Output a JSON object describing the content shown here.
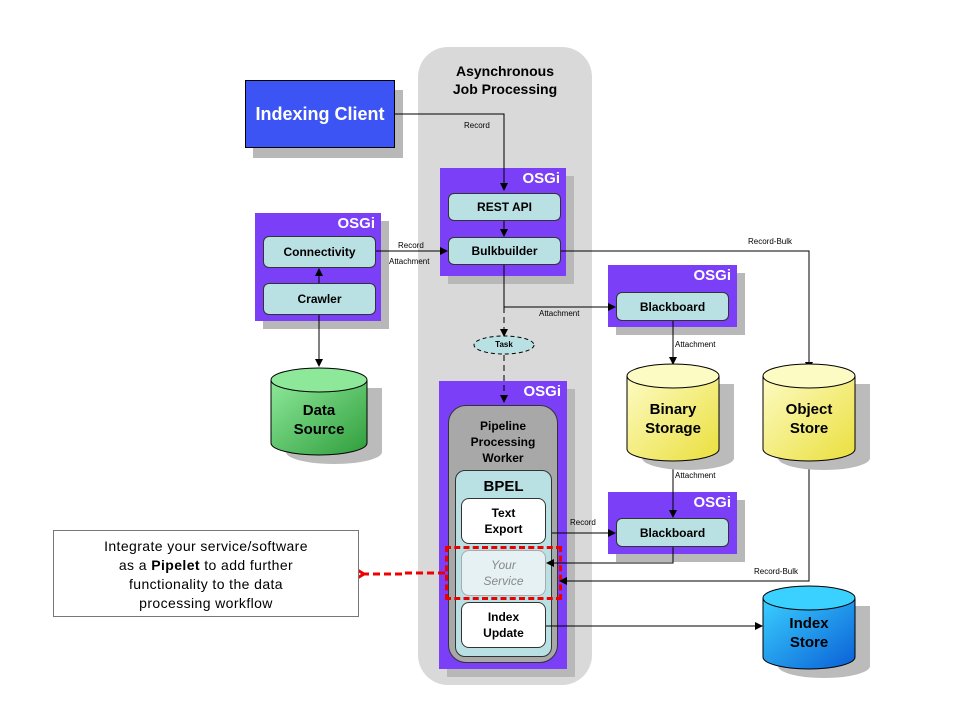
{
  "diagram": {
    "group_title_line1": "Asynchronous",
    "group_title_line2": "Job Processing",
    "indexing_client": "Indexing Client",
    "osgi_label": "OSGi",
    "modules": {
      "rest_api": "REST API",
      "bulkbuilder": "Bulkbuilder",
      "connectivity": "Connectivity",
      "crawler": "Crawler",
      "blackboard_top": "Blackboard",
      "blackboard_bottom": "Blackboard"
    },
    "task": "Task",
    "worker": {
      "line1": "Pipeline",
      "line2": "Processing",
      "line3": "Worker"
    },
    "bpel": "BPEL",
    "pipelets": {
      "text_export_1": "Text",
      "text_export_2": "Export",
      "your_service_1": "Your",
      "your_service_2": "Service",
      "index_update_1": "Index",
      "index_update_2": "Update"
    },
    "stores": {
      "data_source_1": "Data",
      "data_source_2": "Source",
      "binary_storage_1": "Binary",
      "binary_storage_2": "Storage",
      "object_store_1": "Object",
      "object_store_2": "Store",
      "index_store_1": "Index",
      "index_store_2": "Store"
    },
    "edge_labels": {
      "record_client": "Record",
      "record_connectivity": "Record",
      "attachment_connectivity": "Attachment",
      "record_bulk_top": "Record-Bulk",
      "attachment_bulk": "Attachment",
      "attachment_bb_top": "Attachment",
      "attachment_binary": "Attachment",
      "record_text_export": "Record",
      "record_bulk_bottom": "Record-Bulk"
    },
    "callout": {
      "line1": "Integrate  your  service/software",
      "line2_pre": "as a ",
      "line2_bold": "Pipelet",
      "line2_post": " to add further",
      "line3": "functionality  to the  data",
      "line4": "processing  workflow"
    },
    "colors": {
      "osgi": "#7b3ff7",
      "module": "#b9e0e3",
      "client": "#3d54f5",
      "data_source": "#4cc25a",
      "storage_yellow": "#f5ef7a",
      "index_store": "#1f8fe8",
      "highlight": "#e00000"
    }
  }
}
